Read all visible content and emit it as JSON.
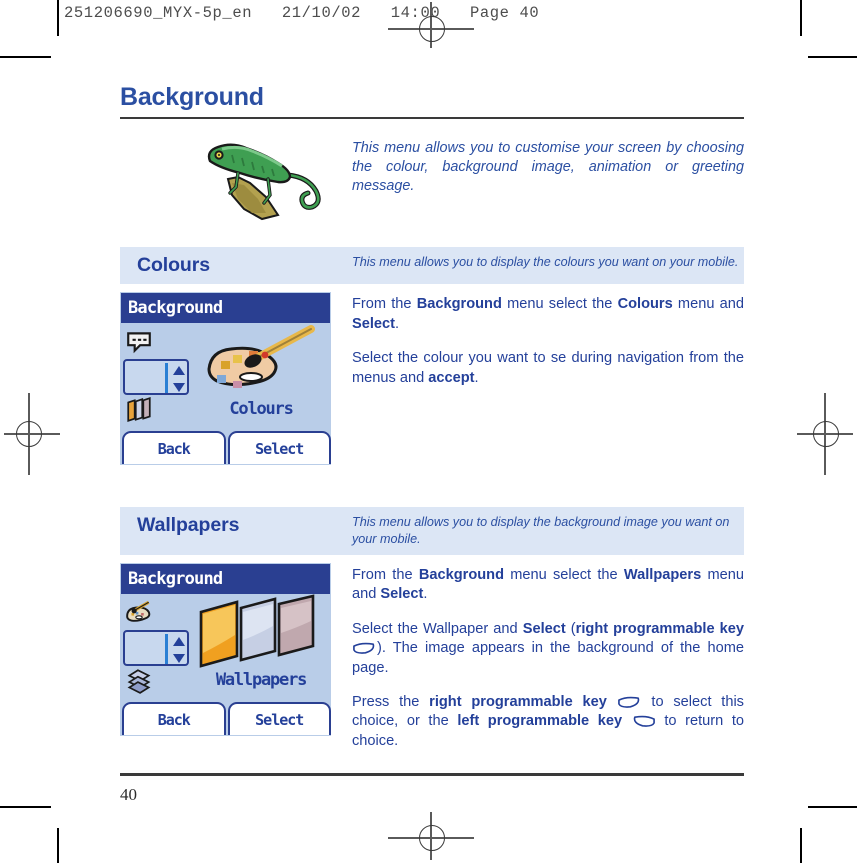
{
  "printer": {
    "slugline": "251206690_MYX-5p_en   21/10/02   14:00   Page 40"
  },
  "page": {
    "title": "Background",
    "number": "40",
    "intro_text": "This menu allows you to customise your screen by choosing the colour, background image, animation or greeting message.",
    "intro_illustration": "chameleon-illustration"
  },
  "sections": [
    {
      "name": "Colours",
      "description": "This menu allows you to display the colours you want on your mobile.",
      "mockup": {
        "title": "Background",
        "label": "Colours",
        "left_softkey": "Back",
        "right_softkey": "Select",
        "selected_icon": "palette-icon",
        "icons": [
          "speech-bubble-icon",
          "palette-icon",
          "wallpapers-icon"
        ],
        "main_art": "palette-with-brush-icon"
      },
      "paragraphs": [
        [
          {
            "t": "From the ",
            "b": false
          },
          {
            "t": "Background",
            "b": true
          },
          {
            "t": " menu select the ",
            "b": false
          },
          {
            "t": "Colours",
            "b": true
          },
          {
            "t": " menu and ",
            "b": false
          },
          {
            "t": "Select",
            "b": true
          },
          {
            "t": ".",
            "b": false
          }
        ],
        [
          {
            "t": "Select the colour you want to se during navigation from the menus and ",
            "b": false
          },
          {
            "t": "accept",
            "b": true
          },
          {
            "t": ".",
            "b": false
          }
        ]
      ]
    },
    {
      "name": "Wallpapers",
      "description": "This menu allows you to display the background image you want on your mobile.",
      "mockup": {
        "title": "Background",
        "label": "Wallpapers",
        "left_softkey": "Back",
        "right_softkey": "Select",
        "selected_icon": "wallpapers-icon",
        "icons": [
          "palette-icon",
          "wallpapers-icon",
          "animation-icon"
        ],
        "main_art": "wallpaper-sheets-icon"
      },
      "paragraphs": [
        [
          {
            "t": "From the ",
            "b": false
          },
          {
            "t": "Background",
            "b": true
          },
          {
            "t": " menu select the ",
            "b": false
          },
          {
            "t": "Wallpapers",
            "b": true
          },
          {
            "t": " menu and ",
            "b": false
          },
          {
            "t": "Select",
            "b": true
          },
          {
            "t": ".",
            "b": false
          }
        ],
        [
          {
            "t": "Select the Wallpaper and ",
            "b": false
          },
          {
            "t": "Select",
            "b": true
          },
          {
            "t": " (",
            "b": false
          },
          {
            "t": "right programmable key",
            "b": true
          },
          {
            "t": " ",
            "b": false
          },
          {
            "k": "right-programmable-key-icon"
          },
          {
            "t": "). The image appears in the background of the home page.",
            "b": false
          }
        ],
        [
          {
            "t": "Press the ",
            "b": false
          },
          {
            "t": "right programmable key",
            "b": true
          },
          {
            "t": " ",
            "b": false
          },
          {
            "k": "right-programmable-key-icon"
          },
          {
            "t": " to select this choice, or the ",
            "b": false
          },
          {
            "t": "left programmable key",
            "b": true
          },
          {
            "t": " ",
            "b": false
          },
          {
            "k": "left-programmable-key-icon"
          },
          {
            "t": " to return to choice.",
            "b": false
          }
        ]
      ]
    }
  ],
  "colors": {
    "title_blue": "#2b4fa2",
    "text_blue": "#24409a",
    "section_bar_bg": "#dce6f5",
    "phone_screen_bg": "#b9cde8",
    "phone_titlebar": "#2a3f91"
  }
}
